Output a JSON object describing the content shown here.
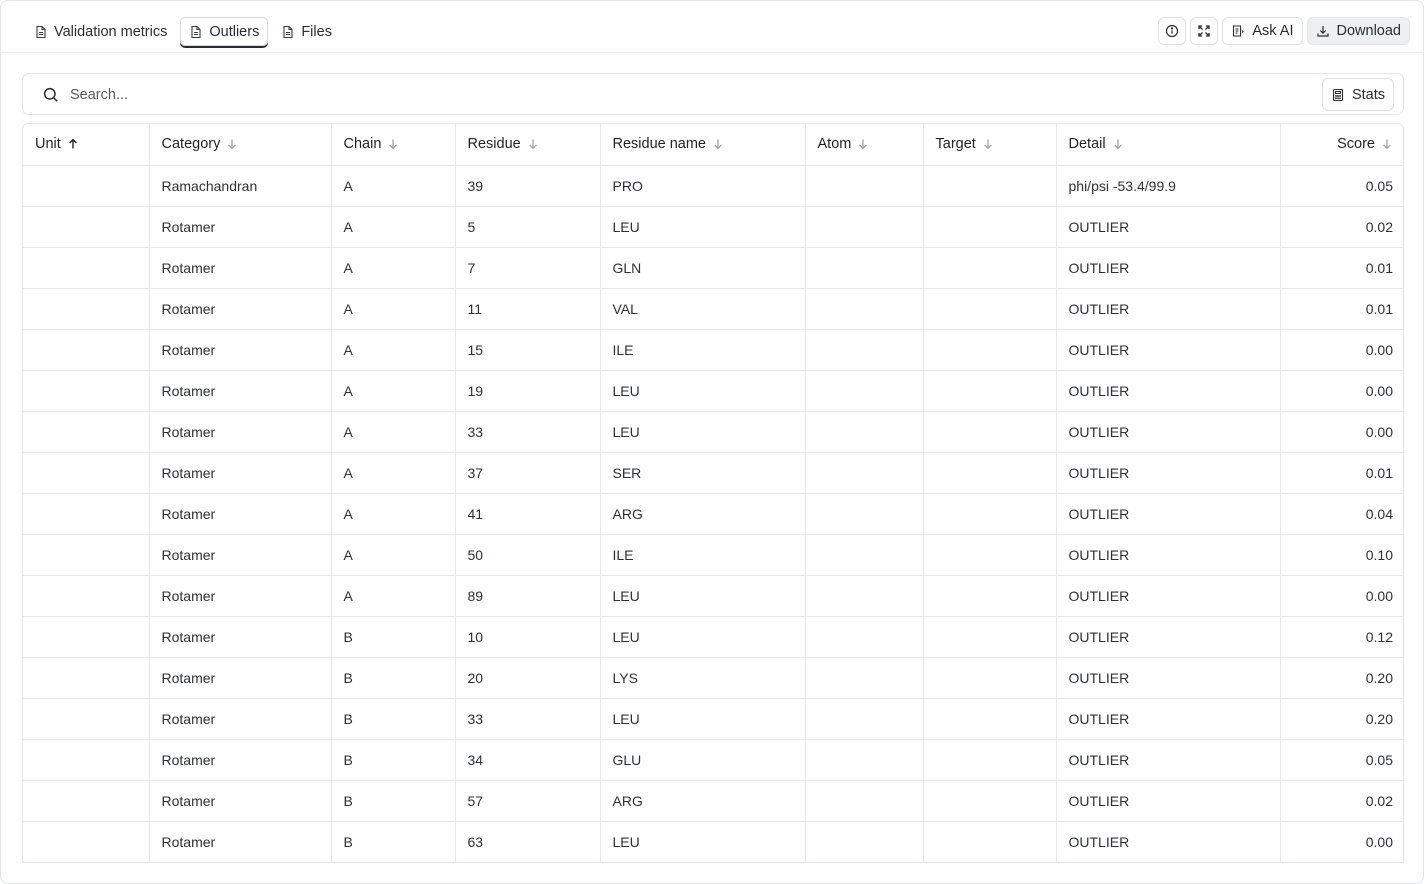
{
  "tabs": [
    {
      "label": "Validation metrics",
      "active": false
    },
    {
      "label": "Outliers",
      "active": true
    },
    {
      "label": "Files",
      "active": false
    }
  ],
  "actions": {
    "ask_ai_label": "Ask AI",
    "download_label": "Download"
  },
  "search": {
    "placeholder": "Search...",
    "value": ""
  },
  "stats_label": "Stats",
  "table": {
    "columns": [
      {
        "label": "Unit",
        "sort": "asc"
      },
      {
        "label": "Category",
        "sort": "desc"
      },
      {
        "label": "Chain",
        "sort": "desc"
      },
      {
        "label": "Residue",
        "sort": "desc"
      },
      {
        "label": "Residue name",
        "sort": "desc"
      },
      {
        "label": "Atom",
        "sort": "desc"
      },
      {
        "label": "Target",
        "sort": "desc"
      },
      {
        "label": "Detail",
        "sort": "desc"
      },
      {
        "label": "Score",
        "sort": "desc"
      }
    ],
    "rows": [
      [
        "",
        "Ramachandran",
        "A",
        "39",
        "PRO",
        "",
        "",
        "phi/psi -53.4/99.9",
        "0.05"
      ],
      [
        "",
        "Rotamer",
        "A",
        "5",
        "LEU",
        "",
        "",
        "OUTLIER",
        "0.02"
      ],
      [
        "",
        "Rotamer",
        "A",
        "7",
        "GLN",
        "",
        "",
        "OUTLIER",
        "0.01"
      ],
      [
        "",
        "Rotamer",
        "A",
        "11",
        "VAL",
        "",
        "",
        "OUTLIER",
        "0.01"
      ],
      [
        "",
        "Rotamer",
        "A",
        "15",
        "ILE",
        "",
        "",
        "OUTLIER",
        "0.00"
      ],
      [
        "",
        "Rotamer",
        "A",
        "19",
        "LEU",
        "",
        "",
        "OUTLIER",
        "0.00"
      ],
      [
        "",
        "Rotamer",
        "A",
        "33",
        "LEU",
        "",
        "",
        "OUTLIER",
        "0.00"
      ],
      [
        "",
        "Rotamer",
        "A",
        "37",
        "SER",
        "",
        "",
        "OUTLIER",
        "0.01"
      ],
      [
        "",
        "Rotamer",
        "A",
        "41",
        "ARG",
        "",
        "",
        "OUTLIER",
        "0.04"
      ],
      [
        "",
        "Rotamer",
        "A",
        "50",
        "ILE",
        "",
        "",
        "OUTLIER",
        "0.10"
      ],
      [
        "",
        "Rotamer",
        "A",
        "89",
        "LEU",
        "",
        "",
        "OUTLIER",
        "0.00"
      ],
      [
        "",
        "Rotamer",
        "B",
        "10",
        "LEU",
        "",
        "",
        "OUTLIER",
        "0.12"
      ],
      [
        "",
        "Rotamer",
        "B",
        "20",
        "LYS",
        "",
        "",
        "OUTLIER",
        "0.20"
      ],
      [
        "",
        "Rotamer",
        "B",
        "33",
        "LEU",
        "",
        "",
        "OUTLIER",
        "0.20"
      ],
      [
        "",
        "Rotamer",
        "B",
        "34",
        "GLU",
        "",
        "",
        "OUTLIER",
        "0.05"
      ],
      [
        "",
        "Rotamer",
        "B",
        "57",
        "ARG",
        "",
        "",
        "OUTLIER",
        "0.02"
      ],
      [
        "",
        "Rotamer",
        "B",
        "63",
        "LEU",
        "",
        "",
        "OUTLIER",
        "0.00"
      ],
      [
        "",
        "",
        "",
        "",
        "",
        "",
        "",
        "",
        ""
      ]
    ]
  }
}
